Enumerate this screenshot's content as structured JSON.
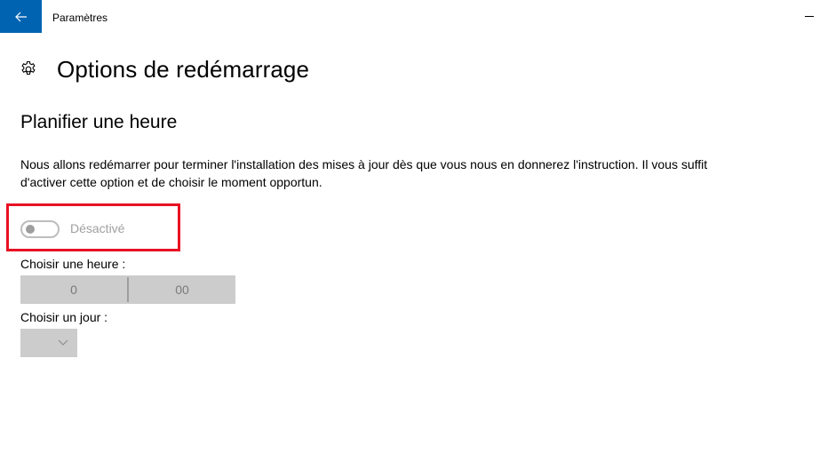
{
  "window": {
    "title": "Paramètres",
    "back_icon": "arrow-left-icon",
    "minimize_icon": "minimize-icon",
    "accent_color": "#0063b1"
  },
  "page": {
    "icon": "gear-icon",
    "title": "Options de redémarrage"
  },
  "schedule": {
    "section_title": "Planifier une heure",
    "description": "Nous allons redémarrer pour terminer l'installation des mises à jour dès que vous nous en donnerez l'instruction. Il vous suffit d'activer cette option et de choisir le moment opportun.",
    "toggle": {
      "state": "off",
      "label": "Désactivé"
    },
    "highlight_color": "#e81123",
    "time": {
      "label": "Choisir une heure :",
      "hour": "0",
      "minute": "00"
    },
    "day": {
      "label": "Choisir un jour :",
      "selected": "",
      "icon": "chevron-down-icon"
    }
  }
}
